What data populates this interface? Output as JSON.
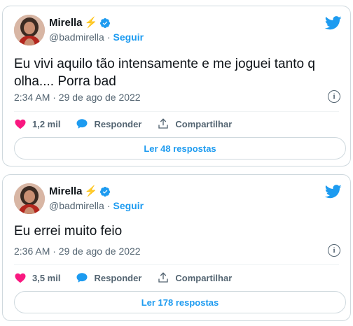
{
  "colors": {
    "accent": "#1d9bf0",
    "like": "#f91880",
    "muted": "#536471",
    "bolt": "#f4b400"
  },
  "tweets": [
    {
      "author_name": "Mirella",
      "bolt_icon": "⚡",
      "handle": "@badmirella",
      "separator": "·",
      "follow_label": "Seguir",
      "text": "Eu vivi aquilo tão intensamente e me joguei tanto q olha.... Porra bad",
      "timestamp": "2:34 AM · 29 de ago de 2022",
      "like_count": "1,2 mil",
      "reply_label": "Responder",
      "share_label": "Compartilhar",
      "read_replies_label": "Ler 48 respostas",
      "info_glyph": "i"
    },
    {
      "author_name": "Mirella",
      "bolt_icon": "⚡",
      "handle": "@badmirella",
      "separator": "·",
      "follow_label": "Seguir",
      "text": "Eu errei muito feio",
      "timestamp": "2:36 AM · 29 de ago de 2022",
      "like_count": "3,5 mil",
      "reply_label": "Responder",
      "share_label": "Compartilhar",
      "read_replies_label": "Ler 178 respostas",
      "info_glyph": "i"
    }
  ]
}
